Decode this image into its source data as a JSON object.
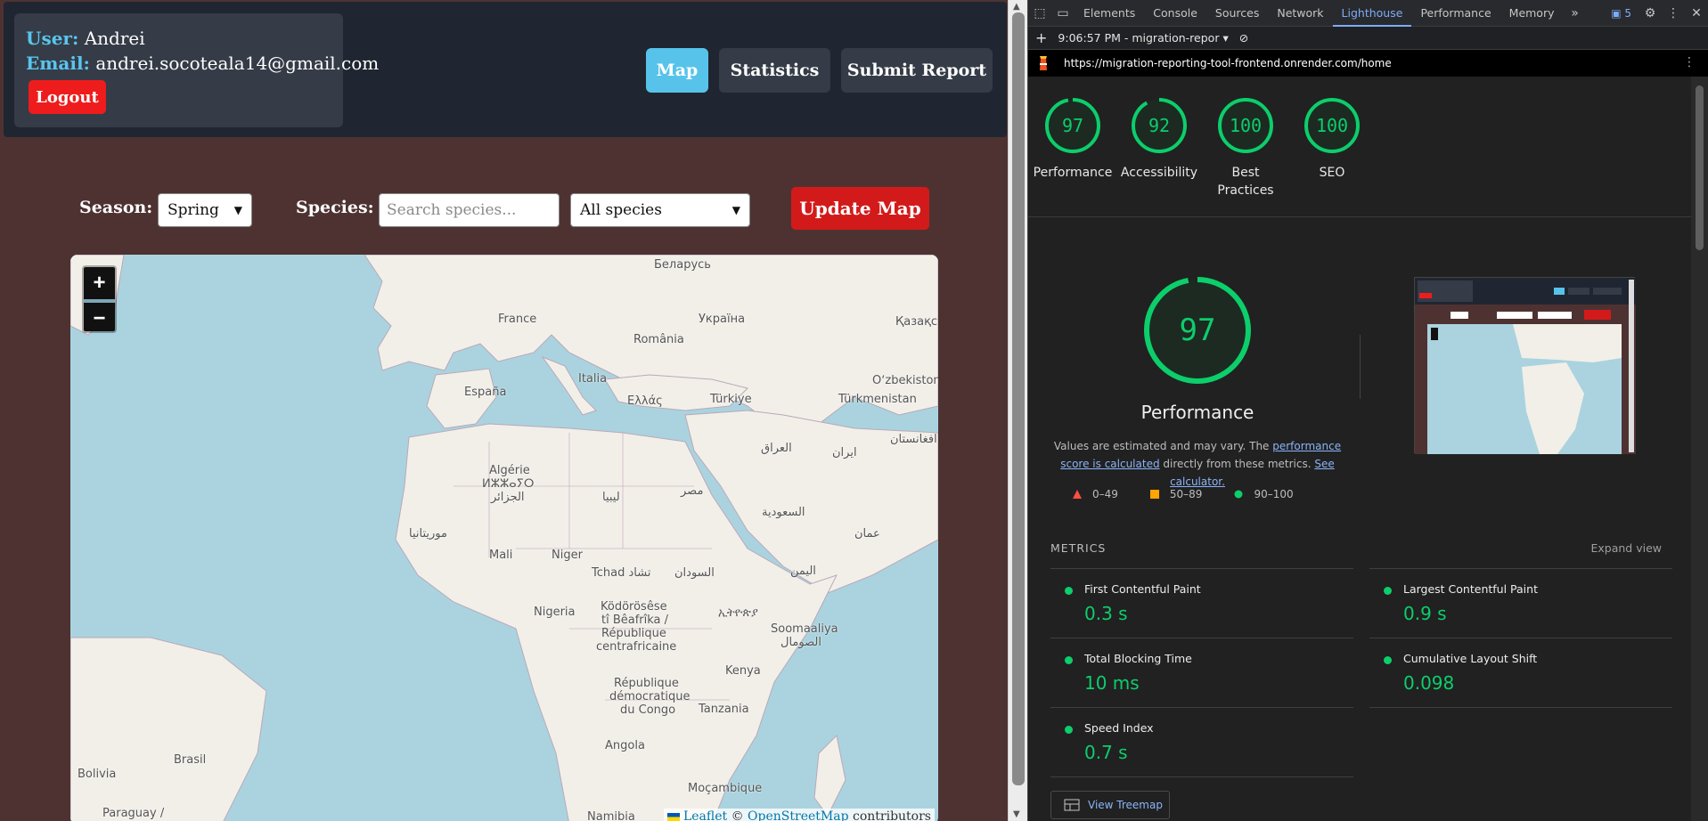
{
  "app": {
    "user_key": "User:",
    "user_name": "Andrei",
    "email_key": "Email:",
    "email": "andrei.socoteala14@gmail.com",
    "logout_label": "Logout",
    "nav": {
      "map": "Map",
      "statistics": "Statistics",
      "submit_report": "Submit Report"
    },
    "filters": {
      "season_label": "Season:",
      "season_value": "Spring",
      "species_label": "Species:",
      "species_placeholder": "Search species...",
      "species_select_value": "All species",
      "update_button": "Update Map"
    },
    "map": {
      "zoom_in": "+",
      "zoom_out": "−",
      "attribution_leaflet": "Leaflet",
      "attribution_sep": "©",
      "attribution_osm": "OpenStreetMap",
      "attribution_suffix": "contributors",
      "labels": [
        {
          "text": "Беларусь"
        },
        {
          "text": "France"
        },
        {
          "text": "Україна"
        },
        {
          "text": "Қазақст"
        },
        {
          "text": "România"
        },
        {
          "text": "Italia"
        },
        {
          "text": "España"
        },
        {
          "text": "Oʻzbekiston"
        },
        {
          "text": "Ελλάς"
        },
        {
          "text": "Türkiye"
        },
        {
          "text": "Türkmenistan"
        },
        {
          "text": "العراق"
        },
        {
          "text": "ایران"
        },
        {
          "text": "افغانستان"
        },
        {
          "text": "Algérie"
        },
        {
          "text": "ⵍⵣⵣⴰⵢⵔ"
        },
        {
          "text": "الجزائر"
        },
        {
          "text": "ليبيا"
        },
        {
          "text": "مصر"
        },
        {
          "text": "السعودية"
        },
        {
          "text": "موريتانيا"
        },
        {
          "text": "عمان"
        },
        {
          "text": "Mali"
        },
        {
          "text": "Niger"
        },
        {
          "text": "Tchad تشاد"
        },
        {
          "text": "السودان"
        },
        {
          "text": "اليمن"
        },
        {
          "text": "Nigeria"
        },
        {
          "text": "Ködörösêse"
        },
        {
          "text": "tî Bêafrîka /"
        },
        {
          "text": "République"
        },
        {
          "text": "centrafricaine"
        },
        {
          "text": "ኢትዮጵያ"
        },
        {
          "text": "Soomaaliya"
        },
        {
          "text": "الصومال"
        },
        {
          "text": "Kenya"
        },
        {
          "text": "République"
        },
        {
          "text": "démocratique"
        },
        {
          "text": "du Congo"
        },
        {
          "text": "Tanzania"
        },
        {
          "text": "Angola"
        },
        {
          "text": "Brasil"
        },
        {
          "text": "Bolivia"
        },
        {
          "text": "Moçambique"
        },
        {
          "text": "Paraguay /"
        },
        {
          "text": "Namibia"
        }
      ]
    }
  },
  "devtools": {
    "tabs": [
      "Elements",
      "Console",
      "Sources",
      "Network",
      "Lighthouse",
      "Performance",
      "Memory"
    ],
    "active_tab": "Lighthouse",
    "issues_count": "5",
    "report_selector": "9:06:57 PM - migration-repor",
    "url": "https://migration-reporting-tool-frontend.onrender.com/home",
    "scores": [
      {
        "label": "Performance",
        "value": 97
      },
      {
        "label": "Accessibility",
        "value": 92
      },
      {
        "label": "Best Practices",
        "value": 100
      },
      {
        "label": "SEO",
        "value": 100
      }
    ],
    "performance": {
      "score": 97,
      "title": "Performance",
      "desc_start": "Values are estimated and may vary. The ",
      "desc_link1": "performance score is calculated",
      "desc_mid": " directly from these metrics. ",
      "desc_link2": "See calculator.",
      "legend": [
        "0–49",
        "50–89",
        "90–100"
      ],
      "colors": {
        "fail": "#ff4e42",
        "average": "#ffa400",
        "pass": "#0cce6b"
      }
    },
    "metrics_title": "METRICS",
    "expand_view": "Expand view",
    "metrics": [
      {
        "name": "First Contentful Paint",
        "value": "0.3 s"
      },
      {
        "name": "Largest Contentful Paint",
        "value": "0.9 s"
      },
      {
        "name": "Total Blocking Time",
        "value": "10 ms"
      },
      {
        "name": "Cumulative Layout Shift",
        "value": "0.098"
      },
      {
        "name": "Speed Index",
        "value": "0.7 s"
      }
    ],
    "treemap_label": "View Treemap",
    "thumbnail": {
      "user": "User: Andrei",
      "email": "Email: andrei.socoteala14@gmail.com",
      "logout": "Logout",
      "nav": [
        "Map",
        "Statistics",
        "Submit Report"
      ],
      "season": "Season:",
      "species": "Species:",
      "update": "Update Map"
    }
  }
}
